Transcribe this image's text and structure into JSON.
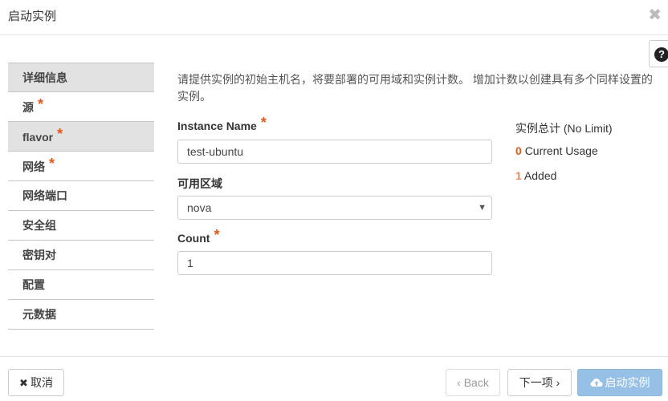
{
  "modal": {
    "title": "启动实例",
    "close_glyph": "✖"
  },
  "help": {
    "glyph": "?"
  },
  "nav": {
    "items": [
      {
        "label": "详细信息",
        "required": false
      },
      {
        "label": "源",
        "required": true
      },
      {
        "label": "flavor",
        "required": true
      },
      {
        "label": "网络",
        "required": true
      },
      {
        "label": "网络端口",
        "required": false
      },
      {
        "label": "安全组",
        "required": false
      },
      {
        "label": "密钥对",
        "required": false
      },
      {
        "label": "配置",
        "required": false
      },
      {
        "label": "元数据",
        "required": false
      }
    ],
    "required_glyph": "*"
  },
  "description": "请提供实例的初始主机名，将要部署的可用域和实例计数。 增加计数以创建具有多个同样设置的实例。",
  "form": {
    "instance_name": {
      "label": "Instance Name",
      "value": "test-ubuntu",
      "required": true
    },
    "availability_zone": {
      "label": "可用区域",
      "value": "nova",
      "caret": "▼"
    },
    "count": {
      "label": "Count",
      "value": "1",
      "required": true
    }
  },
  "stats": {
    "title": "实例总计 (No Limit)",
    "current_usage_value": "0",
    "current_usage_label": "Current Usage",
    "added_value": "1",
    "added_label": "Added",
    "colors": {
      "usage": "#e05a1f",
      "added": "#e88a66"
    }
  },
  "footer": {
    "cancel_icon": "✖",
    "cancel_label": "取消",
    "back_label": "‹ Back",
    "next_label": "下一项 ›",
    "launch_label": "启动实例",
    "launch_icon": "cloud-upload-icon"
  }
}
